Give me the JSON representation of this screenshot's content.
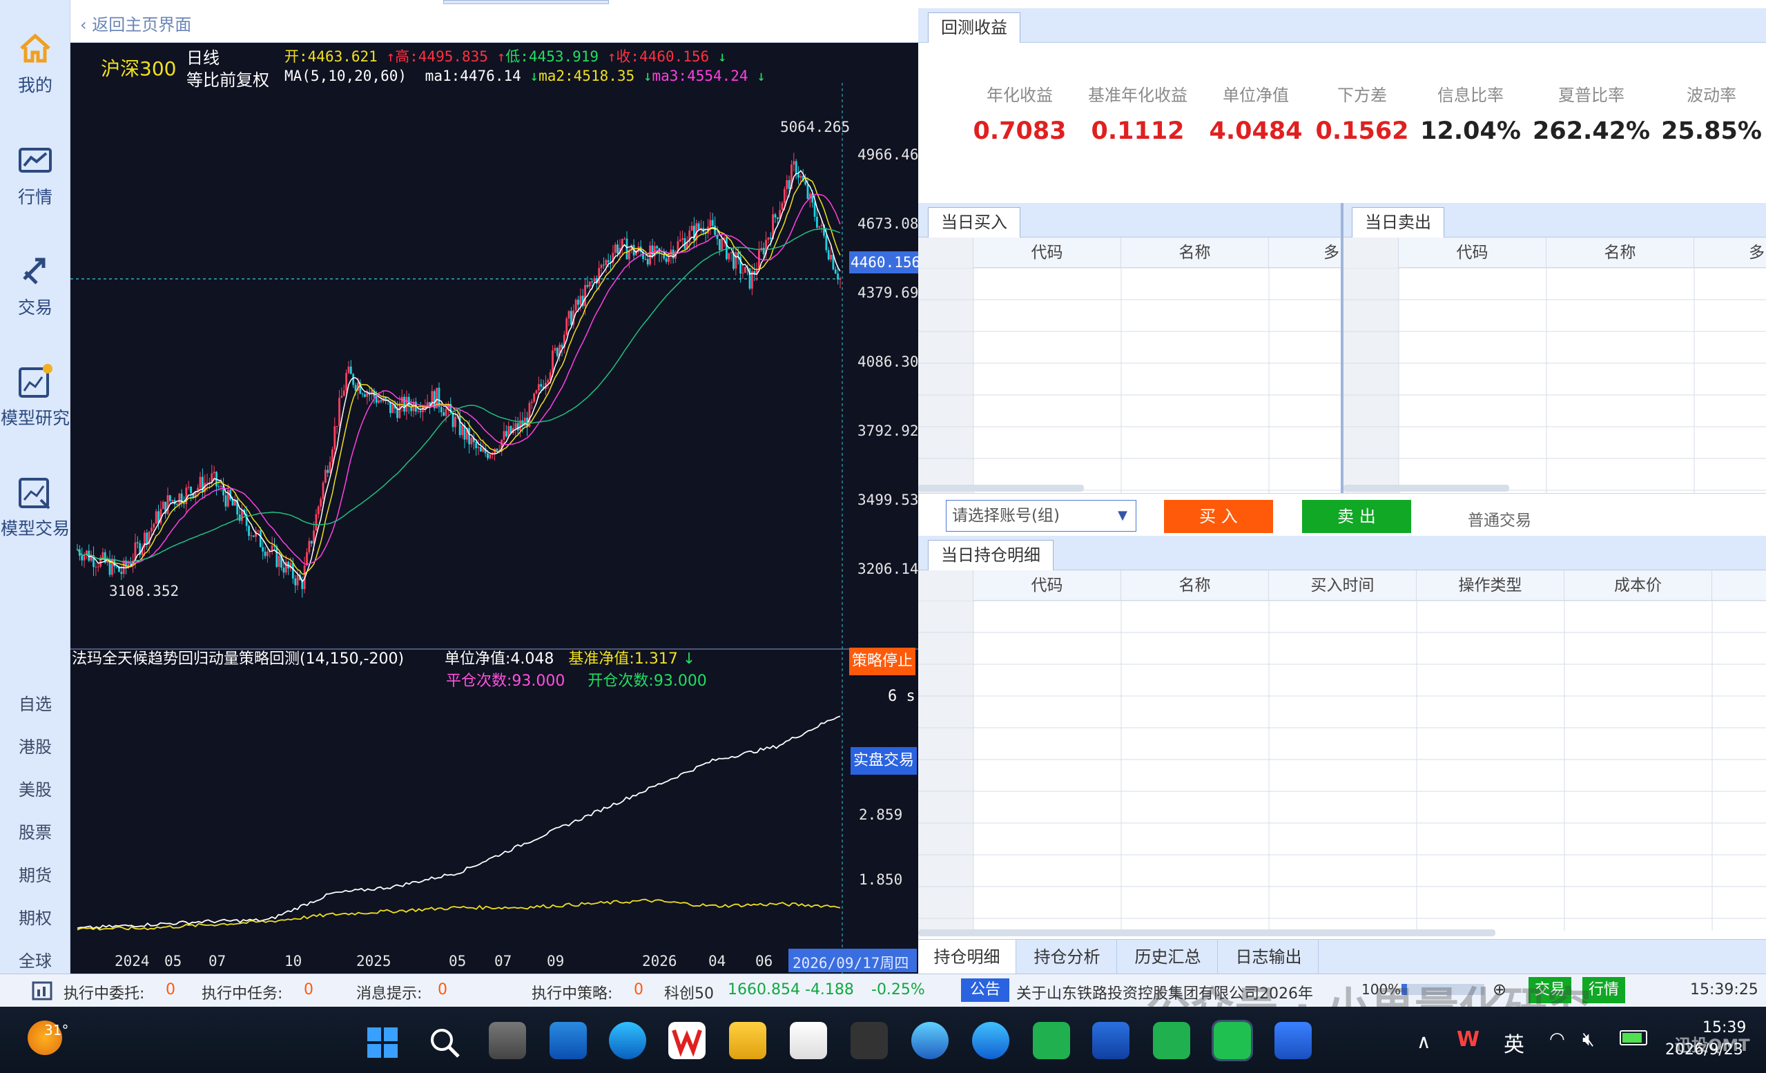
{
  "nav": {
    "main_items": [
      {
        "label": "我的",
        "icon": "home-icon"
      },
      {
        "label": "行情",
        "icon": "market-chart-icon"
      },
      {
        "label": "交易",
        "icon": "trade-arrows-icon"
      },
      {
        "label": "模型研究",
        "icon": "model-research-icon"
      },
      {
        "label": "模型交易",
        "icon": "model-trade-icon"
      }
    ],
    "sub_items": [
      "自选",
      "港股",
      "美股",
      "股票",
      "期货",
      "期权",
      "全球"
    ]
  },
  "chart_panel": {
    "back_label": "返回主页界面",
    "symbol": "沪深300",
    "period": "日线",
    "adjust": "等比前复权",
    "ohlc": {
      "open_label": "开:",
      "open": "4463.621",
      "high_label": "高:",
      "high": "4495.835",
      "low_label": "低:",
      "low": "4453.919",
      "close_label": "收:",
      "close": "4460.156"
    },
    "ma": {
      "params": "MA(5,10,20,60)",
      "ma1_label": "ma1:",
      "ma1": "4476.14",
      "ma2_label": "ma2:",
      "ma2": "4518.35",
      "ma3_label": "ma3:",
      "ma3": "4554.24"
    },
    "price_axis": [
      "4966.469",
      "4673.082",
      "4379.695",
      "4086.309",
      "3792.922",
      "3499.535",
      "3206.148"
    ],
    "current_price_tag": "4460.156",
    "high_marker": "5064.265",
    "low_marker": "3108.352",
    "strategy_title": "法玛全天候趋势回归动量策略回测(14,150,-200)",
    "unit_nav_label": "单位净值:",
    "unit_nav": "4.048",
    "bench_nav_label": "基准净值:",
    "bench_nav": "1.317",
    "close_count_label": "平仓次数:",
    "close_count": "93.000",
    "open_count_label": "开仓次数:",
    "open_count": "93.000",
    "stop_button": "策略停止",
    "timer": "6 s",
    "live_button": "实盘交易",
    "lower_axis": [
      "2.859",
      "1.850"
    ],
    "x_axis": [
      "2024",
      "05",
      "07",
      "10",
      "2025",
      "05",
      "07",
      "09",
      "2026",
      "04",
      "06"
    ],
    "date_tag": "2026/09/17周四"
  },
  "chart_data": [
    {
      "type": "candlestick",
      "title": "沪深300 日线",
      "ylim": [
        3108.352,
        5064.265
      ],
      "x_ticks": [
        "2024",
        "05",
        "07",
        "10",
        "2025",
        "05",
        "07",
        "09",
        "2026",
        "04",
        "06"
      ],
      "approx_close_path": [
        {
          "x": "2024-01",
          "y": 3300
        },
        {
          "x": "2024-02",
          "y": 3200
        },
        {
          "x": "2024-03",
          "y": 3500
        },
        {
          "x": "2024-05",
          "y": 3600
        },
        {
          "x": "2024-07",
          "y": 3350
        },
        {
          "x": "2024-09",
          "y": 3150
        },
        {
          "x": "2024-10",
          "y": 4050
        },
        {
          "x": "2024-12",
          "y": 3900
        },
        {
          "x": "2025-02",
          "y": 3950
        },
        {
          "x": "2025-04",
          "y": 3700
        },
        {
          "x": "2025-06",
          "y": 3850
        },
        {
          "x": "2025-08",
          "y": 4300
        },
        {
          "x": "2025-10",
          "y": 4600
        },
        {
          "x": "2025-12",
          "y": 4550
        },
        {
          "x": "2026-02",
          "y": 4700
        },
        {
          "x": "2026-04",
          "y": 4450
        },
        {
          "x": "2026-06",
          "y": 4950
        },
        {
          "x": "2026-09",
          "y": 4460.156
        }
      ]
    },
    {
      "type": "line",
      "title": "法玛全天候趋势回归动量策略回测(14,150,-200)",
      "series": [
        {
          "name": "单位净值",
          "values": [
            1.0,
            1.05,
            1.1,
            1.12,
            1.5,
            1.6,
            1.8,
            2.2,
            2.6,
            3.0,
            3.4,
            3.6,
            4.048
          ]
        },
        {
          "name": "基准净值",
          "values": [
            1.0,
            1.0,
            1.05,
            1.1,
            1.2,
            1.25,
            1.3,
            1.3,
            1.35,
            1.4,
            1.32,
            1.35,
            1.317
          ]
        }
      ]
    }
  ],
  "backtest": {
    "tab": "回测收益",
    "metrics": [
      {
        "label": "年化收益",
        "value": "0.7083",
        "color": "#e02020"
      },
      {
        "label": "基准年化收益",
        "value": "0.1112",
        "color": "#e02020"
      },
      {
        "label": "单位净值",
        "value": "4.0484",
        "color": "#e02020"
      },
      {
        "label": "下方差",
        "value": "0.1562",
        "color": "#e02020"
      },
      {
        "label": "信息比率",
        "value": "12.04%",
        "color": "#222222"
      },
      {
        "label": "夏普比率",
        "value": "262.42%",
        "color": "#222222"
      },
      {
        "label": "波动率",
        "value": "25.85%",
        "color": "#222222"
      }
    ]
  },
  "buy_panel": {
    "tab": "当日买入",
    "columns": [
      "代码",
      "名称",
      "多"
    ]
  },
  "sell_panel": {
    "tab": "当日卖出",
    "columns": [
      "代码",
      "名称",
      "多"
    ]
  },
  "order_bar": {
    "account_placeholder": "请选择账号(组)",
    "buy_label": "买 入",
    "sell_label": "卖 出",
    "mode_label": "普通交易",
    "buy_color": "#ff5a0a",
    "sell_color": "#10a824"
  },
  "positions": {
    "tab": "当日持仓明细",
    "columns": [
      "代码",
      "名称",
      "买入时间",
      "操作类型",
      "成本价"
    ]
  },
  "bottom_tabs": [
    "持仓明细",
    "持仓分析",
    "历史汇总",
    "日志输出"
  ],
  "status_bar": {
    "exec_orders_label": "执行中委托:",
    "exec_orders": "0",
    "exec_tasks_label": "执行中任务:",
    "exec_tasks": "0",
    "msg_label": "消息提示:",
    "msg": "0",
    "exec_strat_label": "执行中策略:",
    "exec_strat": "0",
    "index_name": "科创50",
    "index_value": "1660.854",
    "index_change": "-4.188",
    "index_pct": "-0.25%",
    "notice_label": "公告",
    "notice_text": "关于山东铁路投资控股集团有限公司2026年",
    "zoom": "100%",
    "trade_btn": "交易",
    "quote_btn": "行情",
    "time": "15:39:25"
  },
  "watermark": "公众号 · 小果量化研究",
  "taskbar": {
    "weather_temp": "31°",
    "ime": "英",
    "clock_time": "15:39",
    "clock_date": "2026/9/23",
    "brand_mark": "迅投QMT"
  }
}
